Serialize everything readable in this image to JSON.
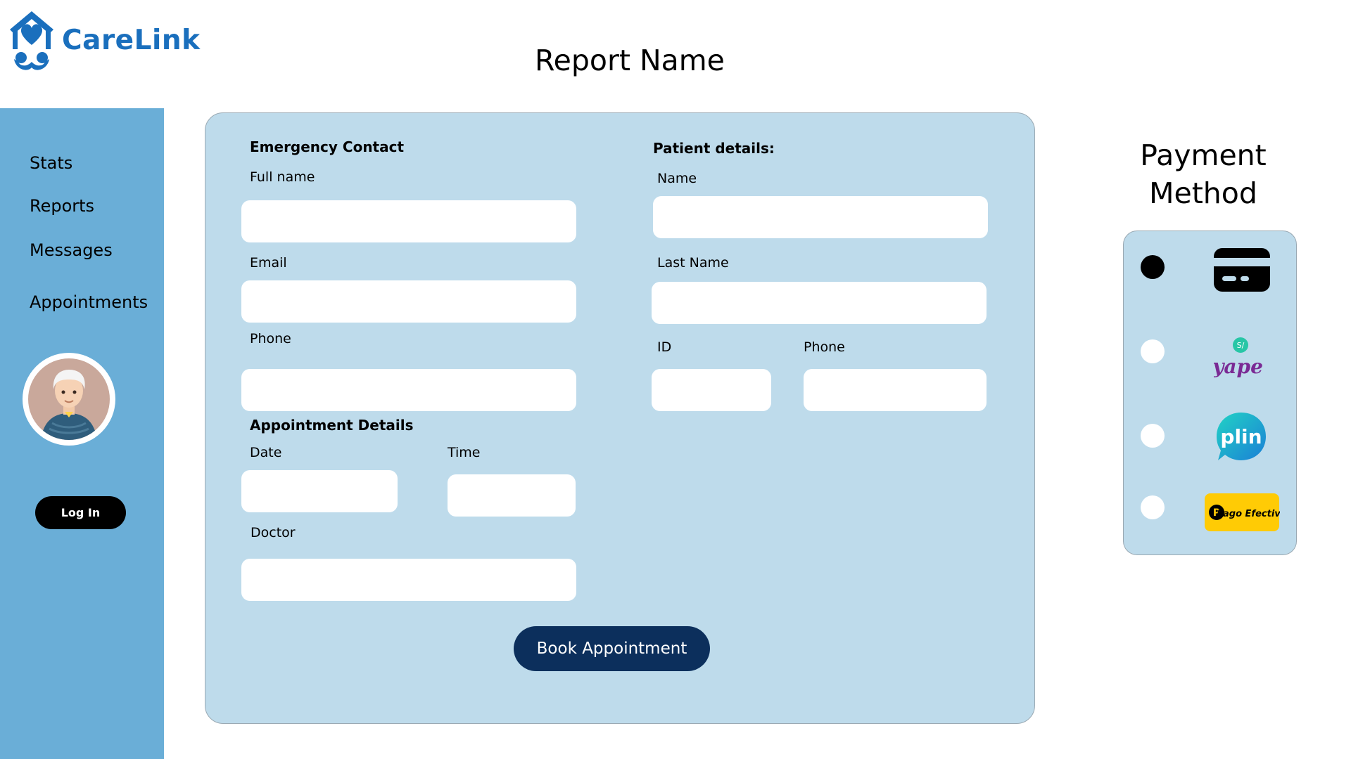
{
  "brand": {
    "name": "CareLink",
    "color": "#1a6fbd"
  },
  "page": {
    "title": "Report Name"
  },
  "sidebar": {
    "background": "#6aaed7",
    "items": [
      {
        "label": "Stats"
      },
      {
        "label": "Reports"
      },
      {
        "label": "Messages"
      },
      {
        "label": "Appointments"
      }
    ],
    "login_label": "Log In"
  },
  "form": {
    "emergency": {
      "title": "Emergency Contact",
      "full_name_label": "Full name",
      "email_label": "Email",
      "phone_label": "Phone"
    },
    "appointment": {
      "title": "Appointment Details",
      "date_label": "Date",
      "time_label": "Time",
      "doctor_label": "Doctor"
    },
    "patient": {
      "title": "Patient details:",
      "name_label": "Name",
      "last_name_label": "Last Name",
      "id_label": "ID",
      "phone_label": "Phone"
    },
    "submit_label": "Book Appointment",
    "card_color": "#bedbeb",
    "button_color": "#0c2f5c"
  },
  "payment": {
    "title": "Payment Method",
    "options": [
      {
        "icon": "credit-card-icon",
        "selected": true
      },
      {
        "icon": "yape-logo-icon",
        "label": "yape",
        "selected": false
      },
      {
        "icon": "plin-logo-icon",
        "label": "plin",
        "selected": false
      },
      {
        "icon": "pagoefectivo-logo-icon",
        "label": "Pago Efectivo",
        "selected": false
      }
    ]
  }
}
